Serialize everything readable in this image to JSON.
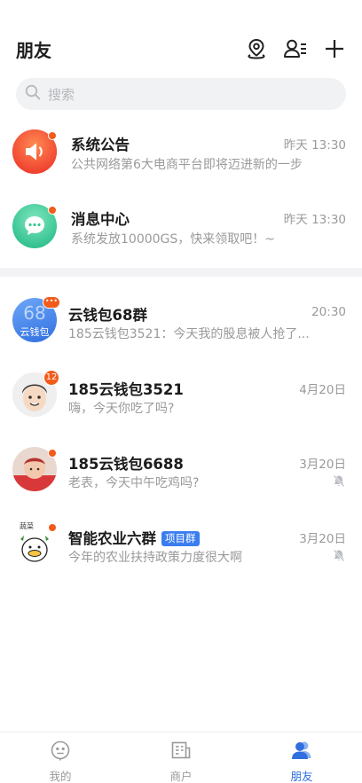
{
  "header": {
    "title": "朋友",
    "icons": [
      "location-pin-icon",
      "contacts-list-icon",
      "plus-icon"
    ]
  },
  "search": {
    "placeholder": "搜索",
    "icon": "search-icon"
  },
  "system_items": [
    {
      "name": "系统公告",
      "message": "公共网络第6大电商平台即将迈进新的一步",
      "time": "昨天 13:30",
      "icon": "megaphone-icon",
      "color": "#f0533a",
      "unread_dot": true
    },
    {
      "name": "消息中心",
      "message": "系统发放10000GS，快来领取吧！~",
      "time": "昨天 13:30",
      "icon": "chat-bubble-icon",
      "color": "#3ccf98",
      "unread_dot": true
    }
  ],
  "chats": [
    {
      "name": "云钱包68群",
      "message": "185云钱包3521：今天我的股息被人抢了...",
      "time": "20:30",
      "avatar_text": "68",
      "avatar_sub": "云钱包",
      "badge": "•••",
      "muted": false
    },
    {
      "name": "185云钱包3521",
      "message": "嗨，今天你吃了吗?",
      "time": "4月20日",
      "badge": "12",
      "muted": false
    },
    {
      "name": "185云钱包6688",
      "message": "老表，今天中午吃鸡吗?",
      "time": "3月20日",
      "badge_dot": true,
      "muted": true
    },
    {
      "name": "智能农业六群",
      "tag": "项目群",
      "message": "今年的农业扶持政策力度很大啊",
      "time": "3月20日",
      "avatar_text": "蔬菜",
      "badge_dot": true,
      "muted": true
    }
  ],
  "tabs": [
    {
      "label": "我的",
      "icon": "robot-face-icon",
      "active": false
    },
    {
      "label": "商户",
      "icon": "merchant-icon",
      "active": false
    },
    {
      "label": "朋友",
      "icon": "friends-icon",
      "active": true
    }
  ],
  "colors": {
    "accent": "#2f6fe0",
    "badge": "#f25b1a",
    "tag": "#3a7df0"
  }
}
